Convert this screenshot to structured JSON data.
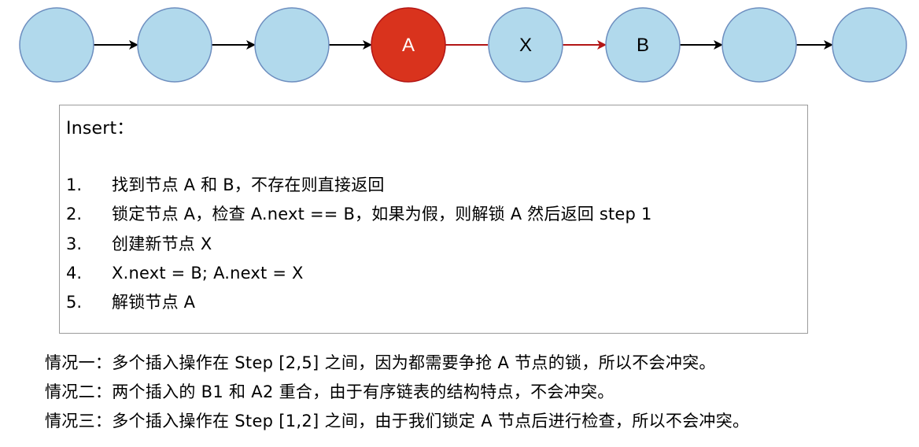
{
  "diagram": {
    "nodes": [
      {
        "label": "",
        "fill": "#b1d9ec",
        "stroke": "#6d8ebf"
      },
      {
        "label": "",
        "fill": "#b1d9ec",
        "stroke": "#6d8ebf"
      },
      {
        "label": "",
        "fill": "#b1d9ec",
        "stroke": "#6d8ebf"
      },
      {
        "label": "A",
        "fill": "#d9331d",
        "stroke": "#b31616",
        "text_color": "#ffffff"
      },
      {
        "label": "X",
        "fill": "#b1d9ec",
        "stroke": "#6d8ebf",
        "text_color": "#000000"
      },
      {
        "label": "B",
        "fill": "#b1d9ec",
        "stroke": "#6d8ebf",
        "text_color": "#000000"
      },
      {
        "label": "",
        "fill": "#b1d9ec",
        "stroke": "#6d8ebf"
      },
      {
        "label": "",
        "fill": "#b1d9ec",
        "stroke": "#6d8ebf"
      }
    ],
    "edges": [
      {
        "from": 0,
        "to": 1,
        "color": "#000000",
        "arrow": true
      },
      {
        "from": 1,
        "to": 2,
        "color": "#000000",
        "arrow": true
      },
      {
        "from": 2,
        "to": 3,
        "color": "#000000",
        "arrow": true
      },
      {
        "from": 3,
        "to": 4,
        "color": "#b31616",
        "arrow": false
      },
      {
        "from": 4,
        "to": 5,
        "color": "#b31616",
        "arrow": true
      },
      {
        "from": 5,
        "to": 6,
        "color": "#000000",
        "arrow": true
      },
      {
        "from": 6,
        "to": 7,
        "color": "#000000",
        "arrow": true
      }
    ]
  },
  "insert": {
    "title": "Insert：",
    "steps": [
      {
        "num": "1.",
        "text": "找到节点 A 和 B，不存在则直接返回"
      },
      {
        "num": "2.",
        "text": "锁定节点 A，检查 A.next == B，如果为假，则解锁 A 然后返回 step 1"
      },
      {
        "num": "3.",
        "text": "创建新节点 X"
      },
      {
        "num": "4.",
        "text": "X.next = B; A.next = X"
      },
      {
        "num": "5.",
        "text": "解锁节点 A"
      }
    ]
  },
  "cases": [
    "情况一：多个插入操作在 Step [2,5] 之间，因为都需要争抢 A 节点的锁，所以不会冲突。",
    "情况二：两个插入的 B1 和 A2 重合，由于有序链表的结构特点，不会冲突。",
    "情况三：多个插入操作在 Step [1,2] 之间，由于我们锁定 A 节点后进行检查，所以不会冲突。"
  ]
}
